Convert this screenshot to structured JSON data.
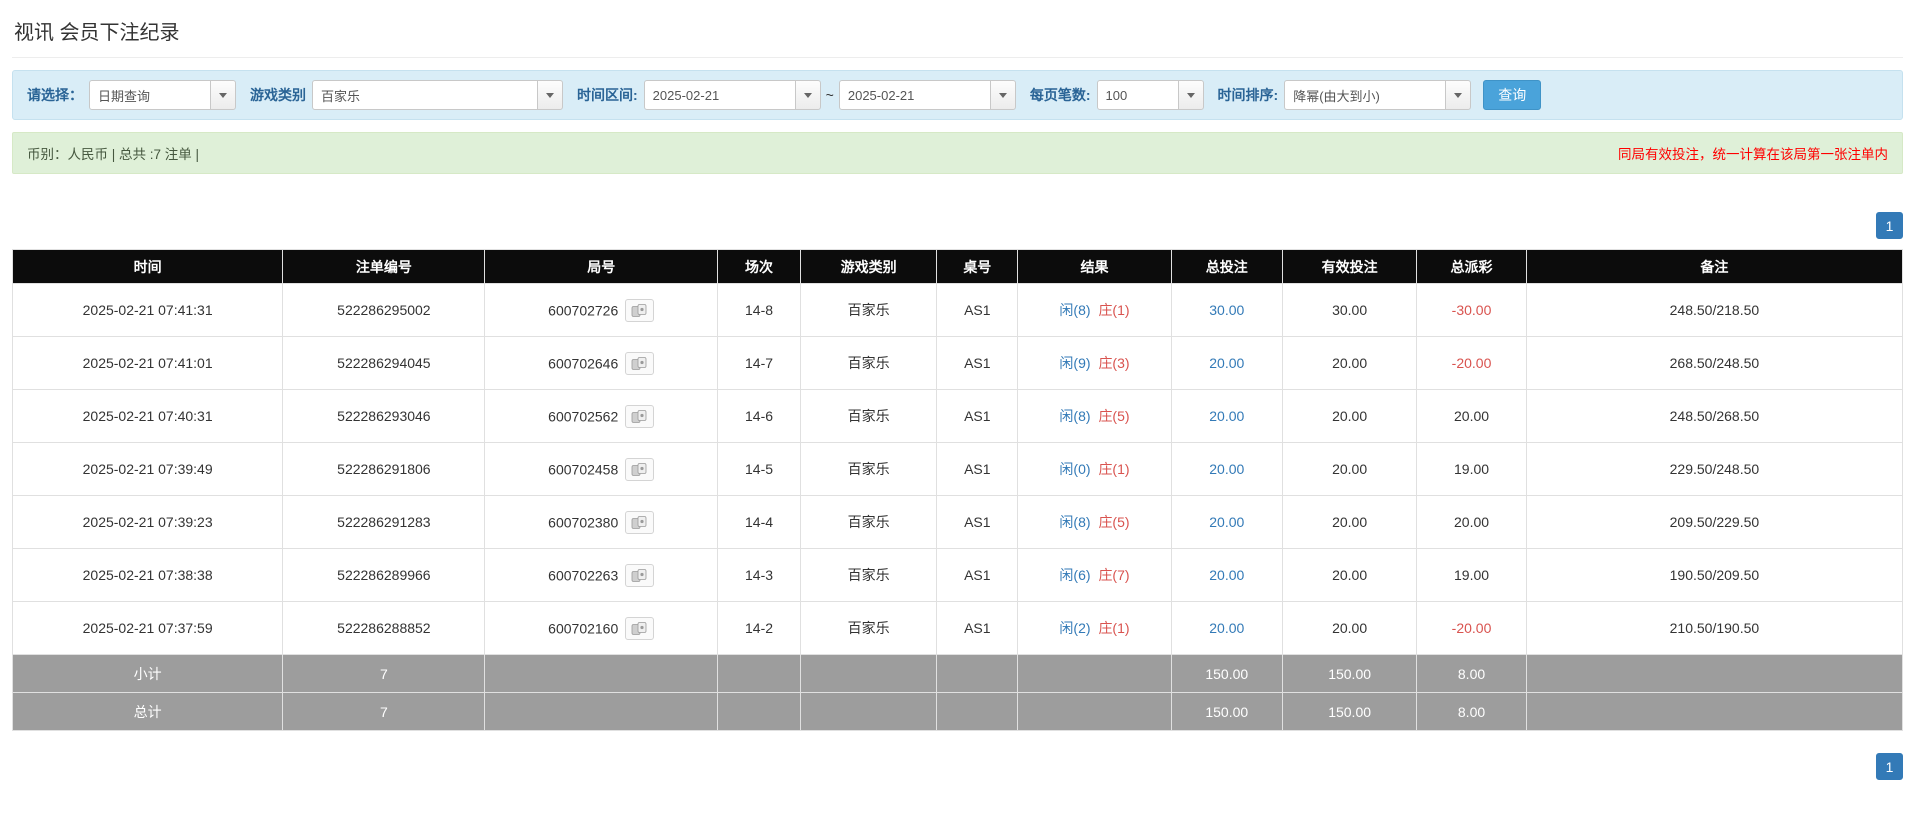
{
  "page": {
    "title": "视讯 会员下注纪录"
  },
  "filters": {
    "select_label": "请选择：",
    "select_value": "日期查询",
    "game_type_label": "游戏类别",
    "game_type_value": "百家乐",
    "date_range_label": "时间区间:",
    "date_from": "2025-02-21",
    "date_to": "2025-02-21",
    "tilde": "~",
    "page_size_label": "每页笔数:",
    "page_size_value": "100",
    "sort_label": "时间排序:",
    "sort_value": "降幂(由大到小)",
    "search_button": "查询"
  },
  "summary": {
    "left": "币别：人民币 | 总共 :7 注单 |",
    "right": "同局有效投注，统一计算在该局第一张注单内"
  },
  "pagination": {
    "page": "1"
  },
  "icons": {
    "combo_button": "chevron-down-icon",
    "round_detail": "game-road-icon"
  },
  "table": {
    "headers": [
      "时间",
      "注单编号",
      "局号",
      "场次",
      "游戏类别",
      "桌号",
      "结果",
      "总投注",
      "有效投注",
      "总派彩",
      "备注"
    ],
    "rows": [
      {
        "time": "2025-02-21 07:41:31",
        "bet_id": "522286295002",
        "round_id": "600702726",
        "session": "14-8",
        "game": "百家乐",
        "table": "AS1",
        "result_player": "闲(8)",
        "result_banker": "庄(1)",
        "total_bet": "30.00",
        "valid_bet": "30.00",
        "payout": "-30.00",
        "remark": "248.50/218.50"
      },
      {
        "time": "2025-02-21 07:41:01",
        "bet_id": "522286294045",
        "round_id": "600702646",
        "session": "14-7",
        "game": "百家乐",
        "table": "AS1",
        "result_player": "闲(9)",
        "result_banker": "庄(3)",
        "total_bet": "20.00",
        "valid_bet": "20.00",
        "payout": "-20.00",
        "remark": "268.50/248.50"
      },
      {
        "time": "2025-02-21 07:40:31",
        "bet_id": "522286293046",
        "round_id": "600702562",
        "session": "14-6",
        "game": "百家乐",
        "table": "AS1",
        "result_player": "闲(8)",
        "result_banker": "庄(5)",
        "total_bet": "20.00",
        "valid_bet": "20.00",
        "payout": "20.00",
        "remark": "248.50/268.50"
      },
      {
        "time": "2025-02-21 07:39:49",
        "bet_id": "522286291806",
        "round_id": "600702458",
        "session": "14-5",
        "game": "百家乐",
        "table": "AS1",
        "result_player": "闲(0)",
        "result_banker": "庄(1)",
        "total_bet": "20.00",
        "valid_bet": "20.00",
        "payout": "19.00",
        "remark": "229.50/248.50"
      },
      {
        "time": "2025-02-21 07:39:23",
        "bet_id": "522286291283",
        "round_id": "600702380",
        "session": "14-4",
        "game": "百家乐",
        "table": "AS1",
        "result_player": "闲(8)",
        "result_banker": "庄(5)",
        "total_bet": "20.00",
        "valid_bet": "20.00",
        "payout": "20.00",
        "remark": "209.50/229.50"
      },
      {
        "time": "2025-02-21 07:38:38",
        "bet_id": "522286289966",
        "round_id": "600702263",
        "session": "14-3",
        "game": "百家乐",
        "table": "AS1",
        "result_player": "闲(6)",
        "result_banker": "庄(7)",
        "total_bet": "20.00",
        "valid_bet": "20.00",
        "payout": "19.00",
        "remark": "190.50/209.50"
      },
      {
        "time": "2025-02-21 07:37:59",
        "bet_id": "522286288852",
        "round_id": "600702160",
        "session": "14-2",
        "game": "百家乐",
        "table": "AS1",
        "result_player": "闲(2)",
        "result_banker": "庄(1)",
        "total_bet": "20.00",
        "valid_bet": "20.00",
        "payout": "-20.00",
        "remark": "210.50/190.50"
      }
    ],
    "subtotal": {
      "label": "小计",
      "count": "7",
      "total_bet": "150.00",
      "valid_bet": "150.00",
      "payout": "8.00"
    },
    "total": {
      "label": "总计",
      "count": "7",
      "total_bet": "150.00",
      "valid_bet": "150.00",
      "payout": "8.00"
    }
  }
}
